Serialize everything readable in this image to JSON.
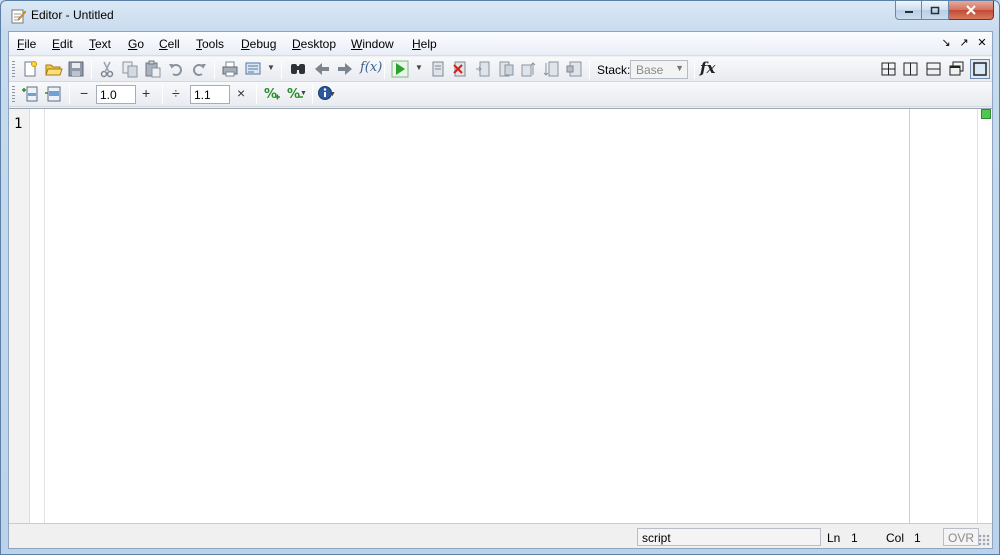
{
  "window": {
    "title": "Editor - Untitled"
  },
  "menubar": {
    "items": [
      "File",
      "Edit",
      "Text",
      "Go",
      "Cell",
      "Tools",
      "Debug",
      "Desktop",
      "Window",
      "Help"
    ]
  },
  "toolbar": {
    "stack_label": "Stack:",
    "stack_value": "Base",
    "fx_label": "fx"
  },
  "cell_toolbar": {
    "minus_symbol": "−",
    "decrement_value": "1.0",
    "plus_symbol": "+",
    "divide_symbol": "÷",
    "divide_value": "1.1",
    "times_symbol": "×"
  },
  "editor": {
    "line_numbers": [
      "1"
    ],
    "analyzer_color": "#4fc84f"
  },
  "statusbar": {
    "file_type": "script",
    "ln_label": "Ln",
    "ln_value": "1",
    "col_label": "Col",
    "col_value": "1",
    "ovr": "OVR"
  }
}
